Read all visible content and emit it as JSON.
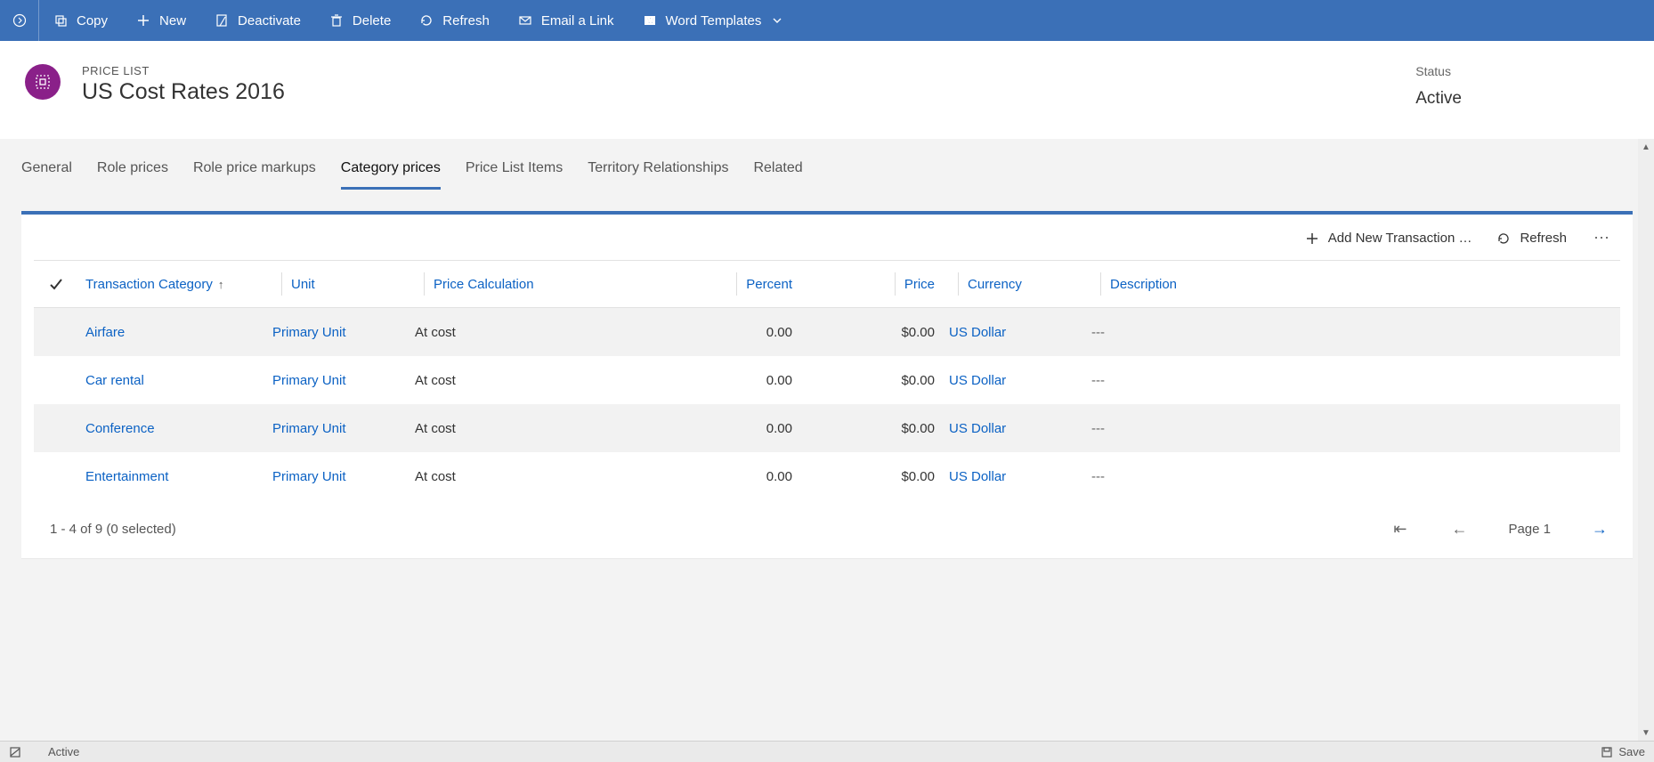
{
  "command_bar": {
    "copy": "Copy",
    "new": "New",
    "deactivate": "Deactivate",
    "delete": "Delete",
    "refresh": "Refresh",
    "email_link": "Email a Link",
    "word_templates": "Word Templates"
  },
  "header": {
    "entity_label": "PRICE LIST",
    "title": "US Cost Rates 2016",
    "status_label": "Status",
    "status_value": "Active"
  },
  "tabs": {
    "items": [
      {
        "label": "General"
      },
      {
        "label": "Role prices"
      },
      {
        "label": "Role price markups"
      },
      {
        "label": "Category prices"
      },
      {
        "label": "Price List Items"
      },
      {
        "label": "Territory Relationships"
      },
      {
        "label": "Related"
      }
    ],
    "active_index": 3
  },
  "grid": {
    "toolbar": {
      "add_new": "Add New Transaction …",
      "refresh": "Refresh"
    },
    "columns": {
      "transaction_category": "Transaction Category",
      "unit": "Unit",
      "price_calculation": "Price Calculation",
      "percent": "Percent",
      "price": "Price",
      "currency": "Currency",
      "description": "Description"
    },
    "rows": [
      {
        "category": "Airfare",
        "unit": "Primary Unit",
        "calc": "At cost",
        "percent": "0.00",
        "price": "$0.00",
        "currency": "US Dollar",
        "desc": "---"
      },
      {
        "category": "Car rental",
        "unit": "Primary Unit",
        "calc": "At cost",
        "percent": "0.00",
        "price": "$0.00",
        "currency": "US Dollar",
        "desc": "---"
      },
      {
        "category": "Conference",
        "unit": "Primary Unit",
        "calc": "At cost",
        "percent": "0.00",
        "price": "$0.00",
        "currency": "US Dollar",
        "desc": "---"
      },
      {
        "category": "Entertainment",
        "unit": "Primary Unit",
        "calc": "At cost",
        "percent": "0.00",
        "price": "$0.00",
        "currency": "US Dollar",
        "desc": "---"
      }
    ],
    "footer": {
      "range_text": "1 - 4 of 9 (0 selected)",
      "page_label": "Page 1"
    }
  },
  "status_bar": {
    "status_text": "Active",
    "save_label": "Save"
  }
}
